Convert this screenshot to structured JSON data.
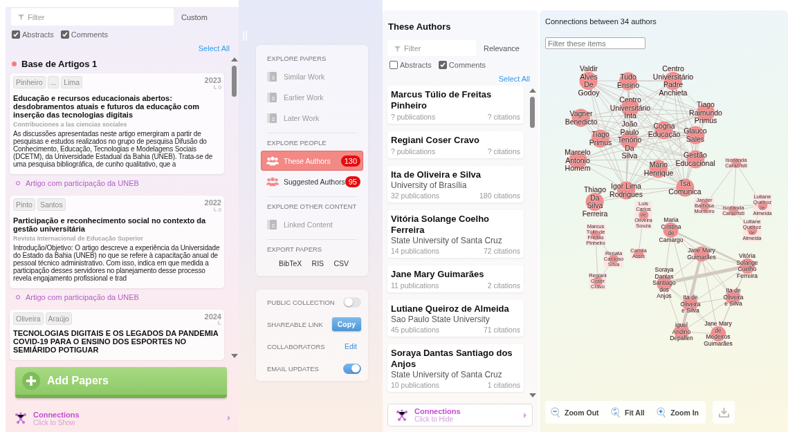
{
  "left_panel": {
    "filter": {
      "placeholder": "Filter"
    },
    "sort": "Custom",
    "options": [
      {
        "label": "Abstracts",
        "checked": true
      },
      {
        "label": "Comments",
        "checked": true
      }
    ],
    "select_all": "Select All",
    "collection": {
      "name": "Base de Artigos 1",
      "papers": [
        {
          "authors": [
            "Pinheiro",
            "...",
            "Lima"
          ],
          "year": "2023",
          "citations": "0",
          "title": "Educação e recursos educacionais abertos: desdobramentos atuais e futuros da educação com inserção das tecnologias digitais",
          "venue": "Contribuciones a las ciencias sociales",
          "abstract": "As discussões apresentadas neste artigo emergiram a partir de pesquisas e estudos realizados no grupo de pesquisa Difusão do Conhecimento, Educação, Tecnologias e Modelagens Sociais (DCETM), da Universidade Estadual da Bahia (UNEB). Trata-se de uma pesquisa bibliográfica, de cunho qualitativo, que a",
          "comment": "Artigo com participação da UNEB"
        },
        {
          "authors": [
            "Pinto",
            "Santos"
          ],
          "year": "2022",
          "citations": "0",
          "title": "Participação e reconhecimento social no contexto da gestão universitária",
          "venue": "Revista Internacional de Educação Superior",
          "abstract": "Introdução/Objetivo: O artigo descreve a experiência da Universidade do Estado da Bahia (UNEB) no que se refere à capacitação anual de pessoal técnico administrativo. Com isso, indica em que medida a participação desses servidores no planejamento desse processo revela engajamento profissional e trad",
          "comment": "Artigo com participação da UNEB"
        },
        {
          "authors": [
            "Oliveira",
            "Araújo"
          ],
          "year": "2024",
          "title": "TECNOLOGIAS DIGITAIS E OS LEGADOS DA PANDEMIA COVID-19 PARA O ENSINO DOS ESPORTES NO SEMIÁRIDO POTIGUAR"
        }
      ]
    },
    "add_button": "Add Papers",
    "footer": {
      "title": "Connections",
      "subtitle": "Click to Show"
    }
  },
  "menu": {
    "sections": [
      {
        "title": "EXPLORE PAPERS",
        "items": [
          {
            "label": "Similar Work",
            "kind": "paper",
            "selected": false,
            "disabled": true
          },
          {
            "label": "Earlier Work",
            "kind": "paper",
            "selected": false,
            "disabled": true
          },
          {
            "label": "Later Work",
            "kind": "paper",
            "selected": false,
            "disabled": true
          }
        ]
      },
      {
        "title": "EXPLORE PEOPLE",
        "items": [
          {
            "label": "These Authors",
            "kind": "people",
            "selected": true,
            "disabled": false,
            "count": "130"
          },
          {
            "label": "Suggested Authors",
            "kind": "people",
            "selected": false,
            "disabled": false,
            "count": "95"
          }
        ]
      },
      {
        "title": "EXPLORE OTHER CONTENT",
        "items": [
          {
            "label": "Linked Content",
            "kind": "paper",
            "selected": false,
            "disabled": true
          }
        ]
      }
    ],
    "export": {
      "title": "EXPORT PAPERS",
      "formats": [
        "BibTeX",
        "RIS",
        "CSV"
      ]
    },
    "settings": [
      {
        "label": "PUBLIC COLLECTION",
        "kind": "toggle",
        "on": false
      },
      {
        "label": "SHAREABLE LINK",
        "kind": "button",
        "action": "Copy"
      },
      {
        "label": "COLLABORATORS",
        "kind": "link",
        "action": "Edit"
      },
      {
        "label": "EMAIL UPDATES",
        "kind": "toggle",
        "on": true
      }
    ]
  },
  "authors_panel": {
    "title": "These Authors",
    "filter": {
      "placeholder": "Filter"
    },
    "sort": "Relevance",
    "options": [
      {
        "label": "Abstracts",
        "checked": false
      },
      {
        "label": "Comments",
        "checked": true
      }
    ],
    "select_all": "Select All",
    "authors": [
      {
        "name": "Marcus Túlio de Freitas Pinheiro",
        "publications": "? publications",
        "citations": "? citations"
      },
      {
        "name": "Regiani Coser Cravo",
        "publications": "? publications",
        "citations": "? citations"
      },
      {
        "name": "Ita de Oliveira e Silva",
        "affiliation": "University of Brasília",
        "publications": "32 publications",
        "citations": "180 citations"
      },
      {
        "name": "Vitória Solange Coelho Ferreira",
        "affiliation": "State University of Santa Cruz",
        "publications": "14 publications",
        "citations": "72 citations"
      },
      {
        "name": "Jane Mary Guimarães",
        "publications": "11 publications",
        "citations": "2 citations"
      },
      {
        "name": "Lutiane Queiroz de Almeida",
        "affiliation": "Sao Paulo State University",
        "publications": "45 publications",
        "citations": "71 citations"
      },
      {
        "name": "Soraya Dantas Santiago dos Anjos",
        "affiliation": "State University of Santa Cruz",
        "publications": "10 publications",
        "citations": "1 citations"
      }
    ],
    "footer": {
      "title": "Connections",
      "subtitle": "Click to Hide"
    }
  },
  "graph": {
    "title": "Connections between 34 authors",
    "filter": {
      "placeholder": "Filter these items"
    },
    "nodes": [
      {
        "label": "Valdir Alves De Godoy",
        "kind": "large"
      },
      {
        "label": "Tudo Ensino",
        "kind": "large"
      },
      {
        "label": "Centro Universitário Padre Anchieta",
        "kind": "large"
      },
      {
        "label": "Vagner Benedicto",
        "kind": "large"
      },
      {
        "label": "Centro Universitário Inta",
        "kind": "large"
      },
      {
        "label": "Tiago Primus",
        "kind": "large"
      },
      {
        "label": "Marcelo Antonio Homem",
        "kind": "large"
      },
      {
        "label": "João Paulo Tenório Da Silva",
        "kind": "large"
      },
      {
        "label": "Cogna Educação",
        "kind": "large"
      },
      {
        "label": "Tiago Raimundo Primus",
        "kind": "large"
      },
      {
        "label": "Glauco Sales",
        "kind": "large"
      },
      {
        "label": "Mário Henrique",
        "kind": "large"
      },
      {
        "label": "Gestão Educacional",
        "kind": "large"
      },
      {
        "label": "Isorlanda Caracristi",
        "kind": "small"
      },
      {
        "label": "Thiago Da Silva Ferreira",
        "kind": "large"
      },
      {
        "label": "Igor Lima Rodrigues",
        "kind": "large"
      },
      {
        "label": "Tsa Comunica",
        "kind": "large"
      },
      {
        "label": "Marcus Túlio de Freitas Pinheiro",
        "kind": "small"
      },
      {
        "label": "Luis Carlos de Oliveira Souza",
        "kind": "small"
      },
      {
        "label": "Jander Barbosa Monteiro",
        "kind": "small"
      },
      {
        "label": "Isorlanda Caracristi",
        "kind": "small"
      },
      {
        "label": "Lutiane Queiroz de Almeida",
        "kind": "small"
      },
      {
        "label": "Maria Cristina de Camargo",
        "kind": "medium"
      },
      {
        "label": "Lutiane Queiroz de Almeida",
        "kind": "small"
      },
      {
        "label": "Renata Cardoso Silva",
        "kind": "small"
      },
      {
        "label": "Camila Assis",
        "kind": "small"
      },
      {
        "label": "Jane Mary Guimarães",
        "kind": "medium"
      },
      {
        "label": "Regiani Coser Cravo",
        "kind": "small"
      },
      {
        "label": "Soraya Dantas Santiago dos Anjos",
        "kind": "medium"
      },
      {
        "label": "Vitória Solange Coelho Ferreira",
        "kind": "medium"
      },
      {
        "label": "Ita de Oliveira e Silva",
        "kind": "medium"
      },
      {
        "label": "Ita de Oliveira e Silva",
        "kind": "medium"
      },
      {
        "label": "iguel Andino Depallen",
        "kind": "medium"
      },
      {
        "label": "Jane Mary de Medeiros Guimarães",
        "kind": "medium"
      }
    ],
    "controls": [
      "Zoom Out",
      "Fit All",
      "Zoom In"
    ]
  }
}
